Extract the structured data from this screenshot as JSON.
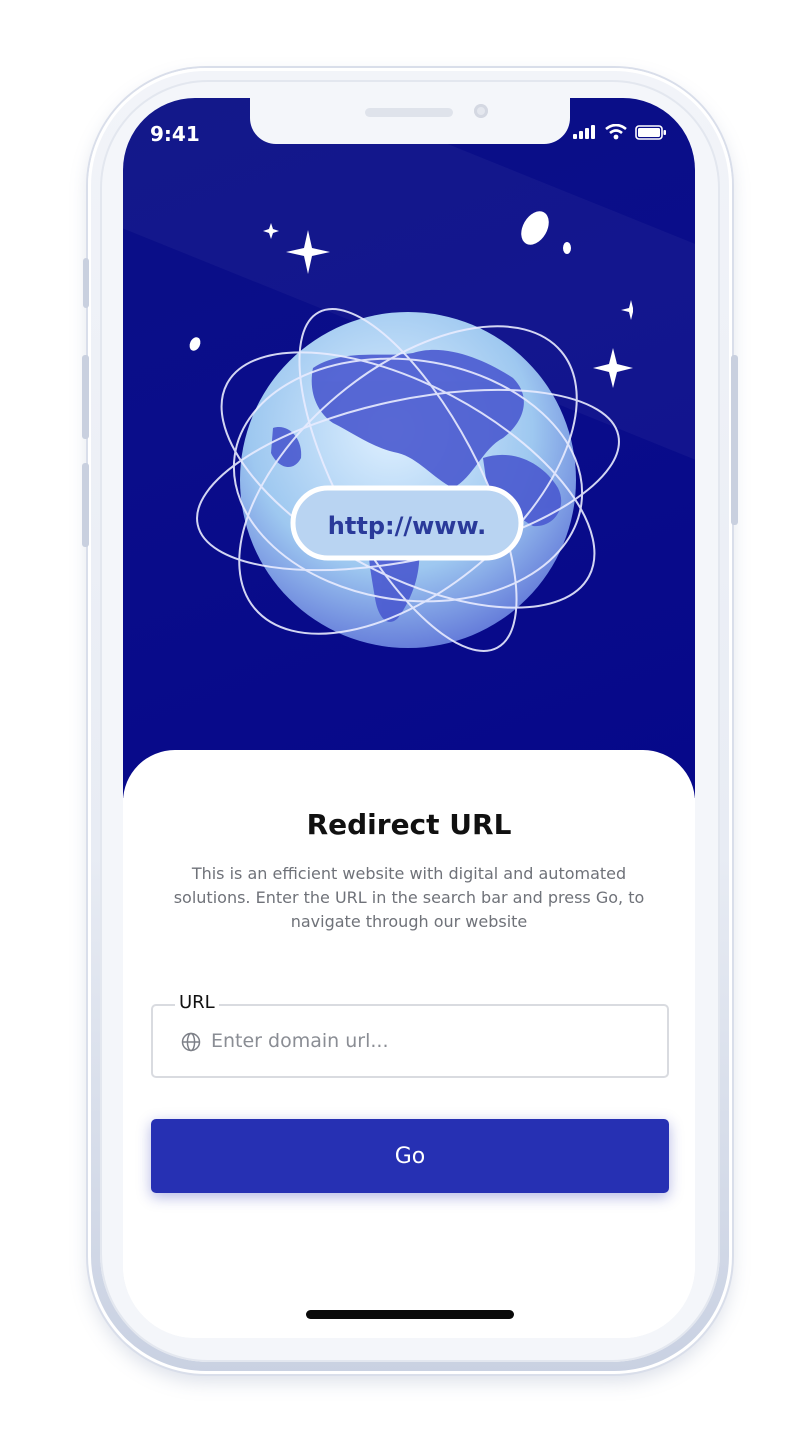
{
  "status_bar": {
    "time": "9:41"
  },
  "hero": {
    "badge_text": "http://www."
  },
  "card": {
    "title": "Redirect URL",
    "description": "This is an efficient website with digital and automated solutions. Enter the URL in the search bar and press Go, to navigate through our website"
  },
  "url_field": {
    "label": "URL",
    "placeholder": "Enter domain url...",
    "value": "",
    "icon": "globe-icon"
  },
  "go_button": {
    "label": "Go"
  },
  "colors": {
    "hero_background": "#0a0f86",
    "primary": "#2630b3",
    "title_text": "#111111",
    "description_text": "#6f7279"
  }
}
